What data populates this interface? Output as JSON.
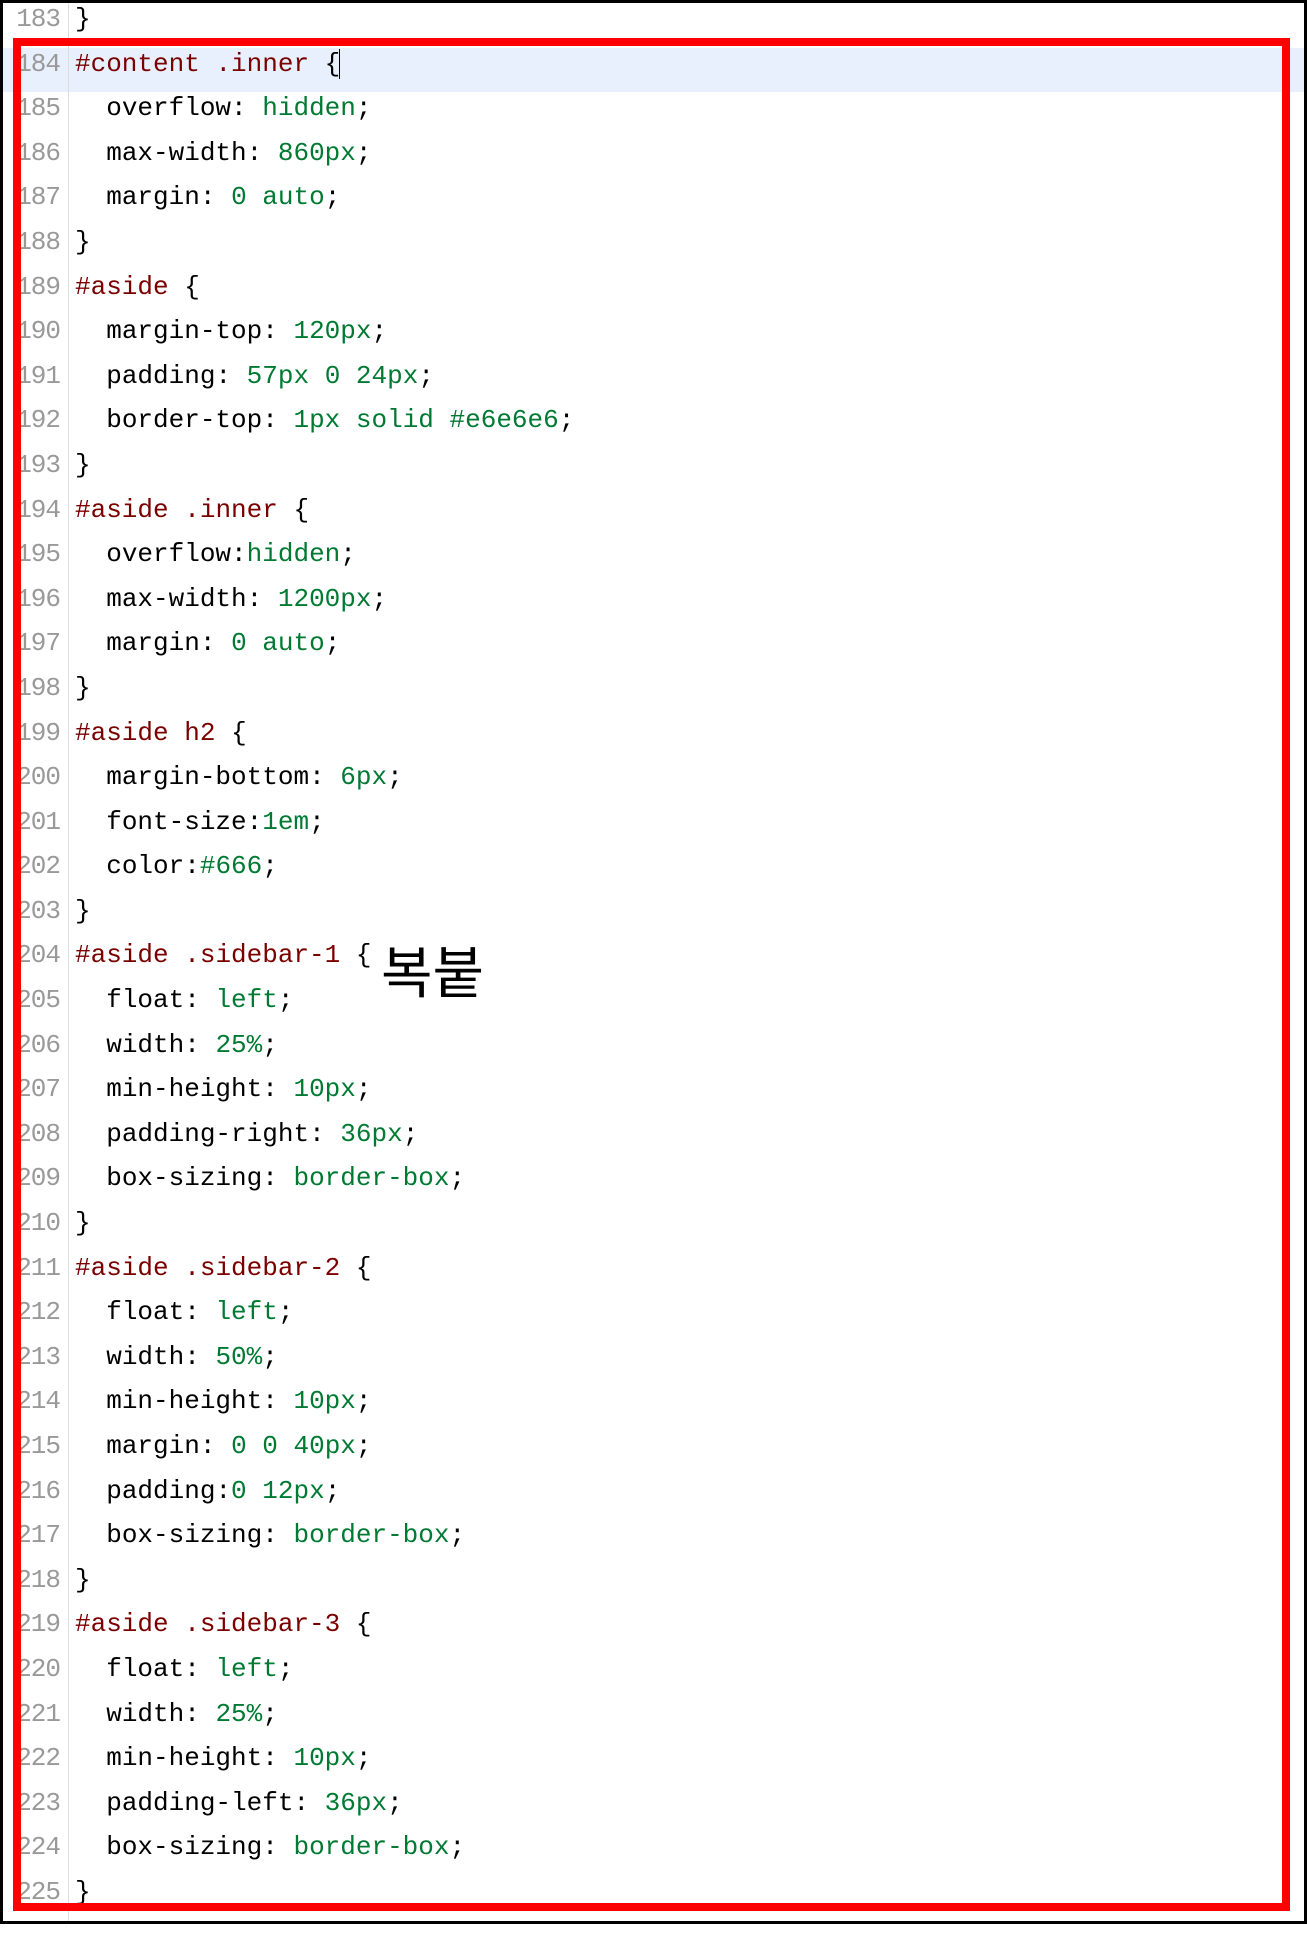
{
  "annotation": "복붙",
  "lines": [
    {
      "n": 183,
      "indent": 0,
      "tokens": [
        {
          "t": "}",
          "c": "tk-brace"
        }
      ]
    },
    {
      "n": 184,
      "indent": 0,
      "current": true,
      "cursor": true,
      "tokens": [
        {
          "t": "#content",
          "c": "tk-sel"
        },
        {
          "t": " ",
          "c": ""
        },
        {
          "t": ".inner",
          "c": "tk-sel"
        },
        {
          "t": " ",
          "c": ""
        },
        {
          "t": "{",
          "c": "tk-brace"
        }
      ]
    },
    {
      "n": 185,
      "indent": 1,
      "tokens": [
        {
          "t": "overflow",
          "c": "tk-prop"
        },
        {
          "t": ": ",
          "c": "tk-punct"
        },
        {
          "t": "hidden",
          "c": "tk-val"
        },
        {
          "t": ";",
          "c": "tk-punct"
        }
      ]
    },
    {
      "n": 186,
      "indent": 1,
      "tokens": [
        {
          "t": "max-width",
          "c": "tk-prop"
        },
        {
          "t": ": ",
          "c": "tk-punct"
        },
        {
          "t": "860px",
          "c": "tk-val"
        },
        {
          "t": ";",
          "c": "tk-punct"
        }
      ]
    },
    {
      "n": 187,
      "indent": 1,
      "tokens": [
        {
          "t": "margin",
          "c": "tk-prop"
        },
        {
          "t": ": ",
          "c": "tk-punct"
        },
        {
          "t": "0",
          "c": "tk-val"
        },
        {
          "t": " ",
          "c": ""
        },
        {
          "t": "auto",
          "c": "tk-val"
        },
        {
          "t": ";",
          "c": "tk-punct"
        }
      ]
    },
    {
      "n": 188,
      "indent": 0,
      "tokens": [
        {
          "t": "}",
          "c": "tk-brace"
        }
      ]
    },
    {
      "n": 189,
      "indent": 0,
      "tokens": [
        {
          "t": "#aside",
          "c": "tk-sel"
        },
        {
          "t": " ",
          "c": ""
        },
        {
          "t": "{",
          "c": "tk-brace"
        }
      ]
    },
    {
      "n": 190,
      "indent": 1,
      "tokens": [
        {
          "t": "margin-top",
          "c": "tk-prop"
        },
        {
          "t": ": ",
          "c": "tk-punct"
        },
        {
          "t": "120px",
          "c": "tk-val"
        },
        {
          "t": ";",
          "c": "tk-punct"
        }
      ]
    },
    {
      "n": 191,
      "indent": 1,
      "tokens": [
        {
          "t": "padding",
          "c": "tk-prop"
        },
        {
          "t": ": ",
          "c": "tk-punct"
        },
        {
          "t": "57px",
          "c": "tk-val"
        },
        {
          "t": " ",
          "c": ""
        },
        {
          "t": "0",
          "c": "tk-val"
        },
        {
          "t": " ",
          "c": ""
        },
        {
          "t": "24px",
          "c": "tk-val"
        },
        {
          "t": ";",
          "c": "tk-punct"
        }
      ]
    },
    {
      "n": 192,
      "indent": 1,
      "tokens": [
        {
          "t": "border-top",
          "c": "tk-prop"
        },
        {
          "t": ": ",
          "c": "tk-punct"
        },
        {
          "t": "1px",
          "c": "tk-val"
        },
        {
          "t": " ",
          "c": ""
        },
        {
          "t": "solid",
          "c": "tk-val"
        },
        {
          "t": " ",
          "c": ""
        },
        {
          "t": "#e6e6e6",
          "c": "tk-val"
        },
        {
          "t": ";",
          "c": "tk-punct"
        }
      ]
    },
    {
      "n": 193,
      "indent": 0,
      "tokens": [
        {
          "t": "}",
          "c": "tk-brace"
        }
      ]
    },
    {
      "n": 194,
      "indent": 0,
      "tokens": [
        {
          "t": "#aside",
          "c": "tk-sel"
        },
        {
          "t": " ",
          "c": ""
        },
        {
          "t": ".inner",
          "c": "tk-sel"
        },
        {
          "t": " ",
          "c": ""
        },
        {
          "t": "{",
          "c": "tk-brace"
        }
      ]
    },
    {
      "n": 195,
      "indent": 1,
      "tokens": [
        {
          "t": "overflow",
          "c": "tk-prop"
        },
        {
          "t": ":",
          "c": "tk-punct"
        },
        {
          "t": "hidden",
          "c": "tk-val"
        },
        {
          "t": ";",
          "c": "tk-punct"
        }
      ]
    },
    {
      "n": 196,
      "indent": 1,
      "tokens": [
        {
          "t": "max-width",
          "c": "tk-prop"
        },
        {
          "t": ": ",
          "c": "tk-punct"
        },
        {
          "t": "1200px",
          "c": "tk-val"
        },
        {
          "t": ";",
          "c": "tk-punct"
        }
      ]
    },
    {
      "n": 197,
      "indent": 1,
      "tokens": [
        {
          "t": "margin",
          "c": "tk-prop"
        },
        {
          "t": ": ",
          "c": "tk-punct"
        },
        {
          "t": "0",
          "c": "tk-val"
        },
        {
          "t": " ",
          "c": ""
        },
        {
          "t": "auto",
          "c": "tk-val"
        },
        {
          "t": ";",
          "c": "tk-punct"
        }
      ]
    },
    {
      "n": 198,
      "indent": 0,
      "tokens": [
        {
          "t": "}",
          "c": "tk-brace"
        }
      ]
    },
    {
      "n": 199,
      "indent": 0,
      "tokens": [
        {
          "t": "#aside",
          "c": "tk-sel"
        },
        {
          "t": " ",
          "c": ""
        },
        {
          "t": "h2",
          "c": "tk-sel"
        },
        {
          "t": " ",
          "c": ""
        },
        {
          "t": "{",
          "c": "tk-brace"
        }
      ]
    },
    {
      "n": 200,
      "indent": 1,
      "tokens": [
        {
          "t": "margin-bottom",
          "c": "tk-prop"
        },
        {
          "t": ": ",
          "c": "tk-punct"
        },
        {
          "t": "6px",
          "c": "tk-val"
        },
        {
          "t": ";",
          "c": "tk-punct"
        }
      ]
    },
    {
      "n": 201,
      "indent": 1,
      "tokens": [
        {
          "t": "font-size",
          "c": "tk-prop"
        },
        {
          "t": ":",
          "c": "tk-punct"
        },
        {
          "t": "1em",
          "c": "tk-val"
        },
        {
          "t": ";",
          "c": "tk-punct"
        }
      ]
    },
    {
      "n": 202,
      "indent": 1,
      "tokens": [
        {
          "t": "color",
          "c": "tk-prop"
        },
        {
          "t": ":",
          "c": "tk-punct"
        },
        {
          "t": "#666",
          "c": "tk-val"
        },
        {
          "t": ";",
          "c": "tk-punct"
        }
      ]
    },
    {
      "n": 203,
      "indent": 0,
      "tokens": [
        {
          "t": "}",
          "c": "tk-brace"
        }
      ]
    },
    {
      "n": 204,
      "indent": 0,
      "tokens": [
        {
          "t": "#aside",
          "c": "tk-sel"
        },
        {
          "t": " ",
          "c": ""
        },
        {
          "t": ".sidebar-1",
          "c": "tk-sel"
        },
        {
          "t": " ",
          "c": ""
        },
        {
          "t": "{",
          "c": "tk-brace"
        }
      ]
    },
    {
      "n": 205,
      "indent": 1,
      "tokens": [
        {
          "t": "float",
          "c": "tk-prop"
        },
        {
          "t": ": ",
          "c": "tk-punct"
        },
        {
          "t": "left",
          "c": "tk-val"
        },
        {
          "t": ";",
          "c": "tk-punct"
        }
      ]
    },
    {
      "n": 206,
      "indent": 1,
      "tokens": [
        {
          "t": "width",
          "c": "tk-prop"
        },
        {
          "t": ": ",
          "c": "tk-punct"
        },
        {
          "t": "25%",
          "c": "tk-val"
        },
        {
          "t": ";",
          "c": "tk-punct"
        }
      ]
    },
    {
      "n": 207,
      "indent": 1,
      "tokens": [
        {
          "t": "min-height",
          "c": "tk-prop"
        },
        {
          "t": ": ",
          "c": "tk-punct"
        },
        {
          "t": "10px",
          "c": "tk-val"
        },
        {
          "t": ";",
          "c": "tk-punct"
        }
      ]
    },
    {
      "n": 208,
      "indent": 1,
      "tokens": [
        {
          "t": "padding-right",
          "c": "tk-prop"
        },
        {
          "t": ": ",
          "c": "tk-punct"
        },
        {
          "t": "36px",
          "c": "tk-val"
        },
        {
          "t": ";",
          "c": "tk-punct"
        }
      ]
    },
    {
      "n": 209,
      "indent": 1,
      "tokens": [
        {
          "t": "box-sizing",
          "c": "tk-prop"
        },
        {
          "t": ": ",
          "c": "tk-punct"
        },
        {
          "t": "border-box",
          "c": "tk-val"
        },
        {
          "t": ";",
          "c": "tk-punct"
        }
      ]
    },
    {
      "n": 210,
      "indent": 0,
      "tokens": [
        {
          "t": "}",
          "c": "tk-brace"
        }
      ]
    },
    {
      "n": 211,
      "indent": 0,
      "tokens": [
        {
          "t": "#aside",
          "c": "tk-sel"
        },
        {
          "t": " ",
          "c": ""
        },
        {
          "t": ".sidebar-2",
          "c": "tk-sel"
        },
        {
          "t": " ",
          "c": ""
        },
        {
          "t": "{",
          "c": "tk-brace"
        }
      ]
    },
    {
      "n": 212,
      "indent": 1,
      "tokens": [
        {
          "t": "float",
          "c": "tk-prop"
        },
        {
          "t": ": ",
          "c": "tk-punct"
        },
        {
          "t": "left",
          "c": "tk-val"
        },
        {
          "t": ";",
          "c": "tk-punct"
        }
      ]
    },
    {
      "n": 213,
      "indent": 1,
      "tokens": [
        {
          "t": "width",
          "c": "tk-prop"
        },
        {
          "t": ": ",
          "c": "tk-punct"
        },
        {
          "t": "50%",
          "c": "tk-val"
        },
        {
          "t": ";",
          "c": "tk-punct"
        }
      ]
    },
    {
      "n": 214,
      "indent": 1,
      "tokens": [
        {
          "t": "min-height",
          "c": "tk-prop"
        },
        {
          "t": ": ",
          "c": "tk-punct"
        },
        {
          "t": "10px",
          "c": "tk-val"
        },
        {
          "t": ";",
          "c": "tk-punct"
        }
      ]
    },
    {
      "n": 215,
      "indent": 1,
      "tokens": [
        {
          "t": "margin",
          "c": "tk-prop"
        },
        {
          "t": ": ",
          "c": "tk-punct"
        },
        {
          "t": "0",
          "c": "tk-val"
        },
        {
          "t": " ",
          "c": ""
        },
        {
          "t": "0",
          "c": "tk-val"
        },
        {
          "t": " ",
          "c": ""
        },
        {
          "t": "40px",
          "c": "tk-val"
        },
        {
          "t": ";",
          "c": "tk-punct"
        }
      ]
    },
    {
      "n": 216,
      "indent": 1,
      "tokens": [
        {
          "t": "padding",
          "c": "tk-prop"
        },
        {
          "t": ":",
          "c": "tk-punct"
        },
        {
          "t": "0",
          "c": "tk-val"
        },
        {
          "t": " ",
          "c": ""
        },
        {
          "t": "12px",
          "c": "tk-val"
        },
        {
          "t": ";",
          "c": "tk-punct"
        }
      ]
    },
    {
      "n": 217,
      "indent": 1,
      "tokens": [
        {
          "t": "box-sizing",
          "c": "tk-prop"
        },
        {
          "t": ": ",
          "c": "tk-punct"
        },
        {
          "t": "border-box",
          "c": "tk-val"
        },
        {
          "t": ";",
          "c": "tk-punct"
        }
      ]
    },
    {
      "n": 218,
      "indent": 0,
      "tokens": [
        {
          "t": "}",
          "c": "tk-brace"
        }
      ]
    },
    {
      "n": 219,
      "indent": 0,
      "tokens": [
        {
          "t": "#aside",
          "c": "tk-sel"
        },
        {
          "t": " ",
          "c": ""
        },
        {
          "t": ".sidebar-3",
          "c": "tk-sel"
        },
        {
          "t": " ",
          "c": ""
        },
        {
          "t": "{",
          "c": "tk-brace"
        }
      ]
    },
    {
      "n": 220,
      "indent": 1,
      "tokens": [
        {
          "t": "float",
          "c": "tk-prop"
        },
        {
          "t": ": ",
          "c": "tk-punct"
        },
        {
          "t": "left",
          "c": "tk-val"
        },
        {
          "t": ";",
          "c": "tk-punct"
        }
      ]
    },
    {
      "n": 221,
      "indent": 1,
      "tokens": [
        {
          "t": "width",
          "c": "tk-prop"
        },
        {
          "t": ": ",
          "c": "tk-punct"
        },
        {
          "t": "25%",
          "c": "tk-val"
        },
        {
          "t": ";",
          "c": "tk-punct"
        }
      ]
    },
    {
      "n": 222,
      "indent": 1,
      "tokens": [
        {
          "t": "min-height",
          "c": "tk-prop"
        },
        {
          "t": ": ",
          "c": "tk-punct"
        },
        {
          "t": "10px",
          "c": "tk-val"
        },
        {
          "t": ";",
          "c": "tk-punct"
        }
      ]
    },
    {
      "n": 223,
      "indent": 1,
      "tokens": [
        {
          "t": "padding-left",
          "c": "tk-prop"
        },
        {
          "t": ": ",
          "c": "tk-punct"
        },
        {
          "t": "36px",
          "c": "tk-val"
        },
        {
          "t": ";",
          "c": "tk-punct"
        }
      ]
    },
    {
      "n": 224,
      "indent": 1,
      "tokens": [
        {
          "t": "box-sizing",
          "c": "tk-prop"
        },
        {
          "t": ": ",
          "c": "tk-punct"
        },
        {
          "t": "border-box",
          "c": "tk-val"
        },
        {
          "t": ";",
          "c": "tk-punct"
        }
      ]
    },
    {
      "n": 225,
      "indent": 0,
      "tokens": [
        {
          "t": "}",
          "c": "tk-brace"
        }
      ]
    }
  ]
}
